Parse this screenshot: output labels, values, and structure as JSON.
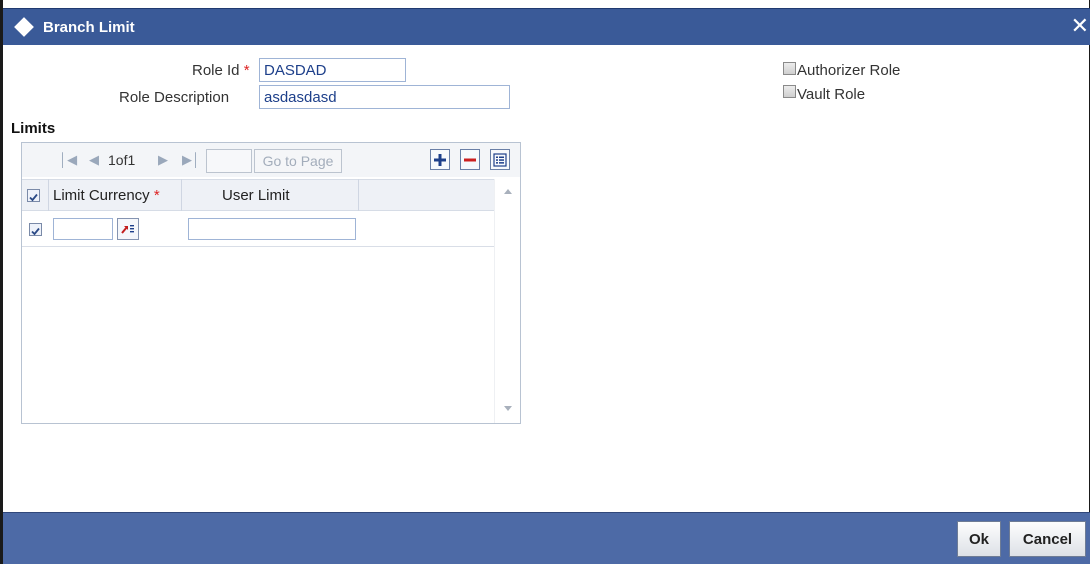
{
  "window": {
    "title": "Branch Limit",
    "close_glyph": "✕"
  },
  "form": {
    "role_id_label": "Role Id",
    "role_id_value": "DASDAD",
    "role_desc_label": "Role Description",
    "role_desc_value": "asdasdasd",
    "required_mark": "*",
    "authorizer_role_label": "Authorizer Role",
    "vault_role_label": "Vault Role"
  },
  "limits": {
    "section_title": "Limits",
    "pager": {
      "text": "1of1",
      "goto_label": "Go to Page"
    },
    "columns": [
      "Limit Currency",
      "User Limit"
    ],
    "rows": [
      {
        "selected": true,
        "limit_currency": "",
        "user_limit": ""
      }
    ]
  },
  "footer": {
    "ok_label": "Ok",
    "cancel_label": "Cancel"
  },
  "colors": {
    "titlebar": "#3a5a98",
    "footer": "#4d6aa6",
    "required": "#dd2222",
    "input_text": "#1d3f8a"
  },
  "icons": [
    "diamond-icon",
    "close-icon",
    "first-page-icon",
    "prev-page-icon",
    "next-page-icon",
    "last-page-icon",
    "add-row-icon",
    "delete-row-icon",
    "single-view-icon",
    "lov-icon",
    "scroll-up-icon",
    "scroll-down-icon",
    "checkbox-checked-icon"
  ]
}
